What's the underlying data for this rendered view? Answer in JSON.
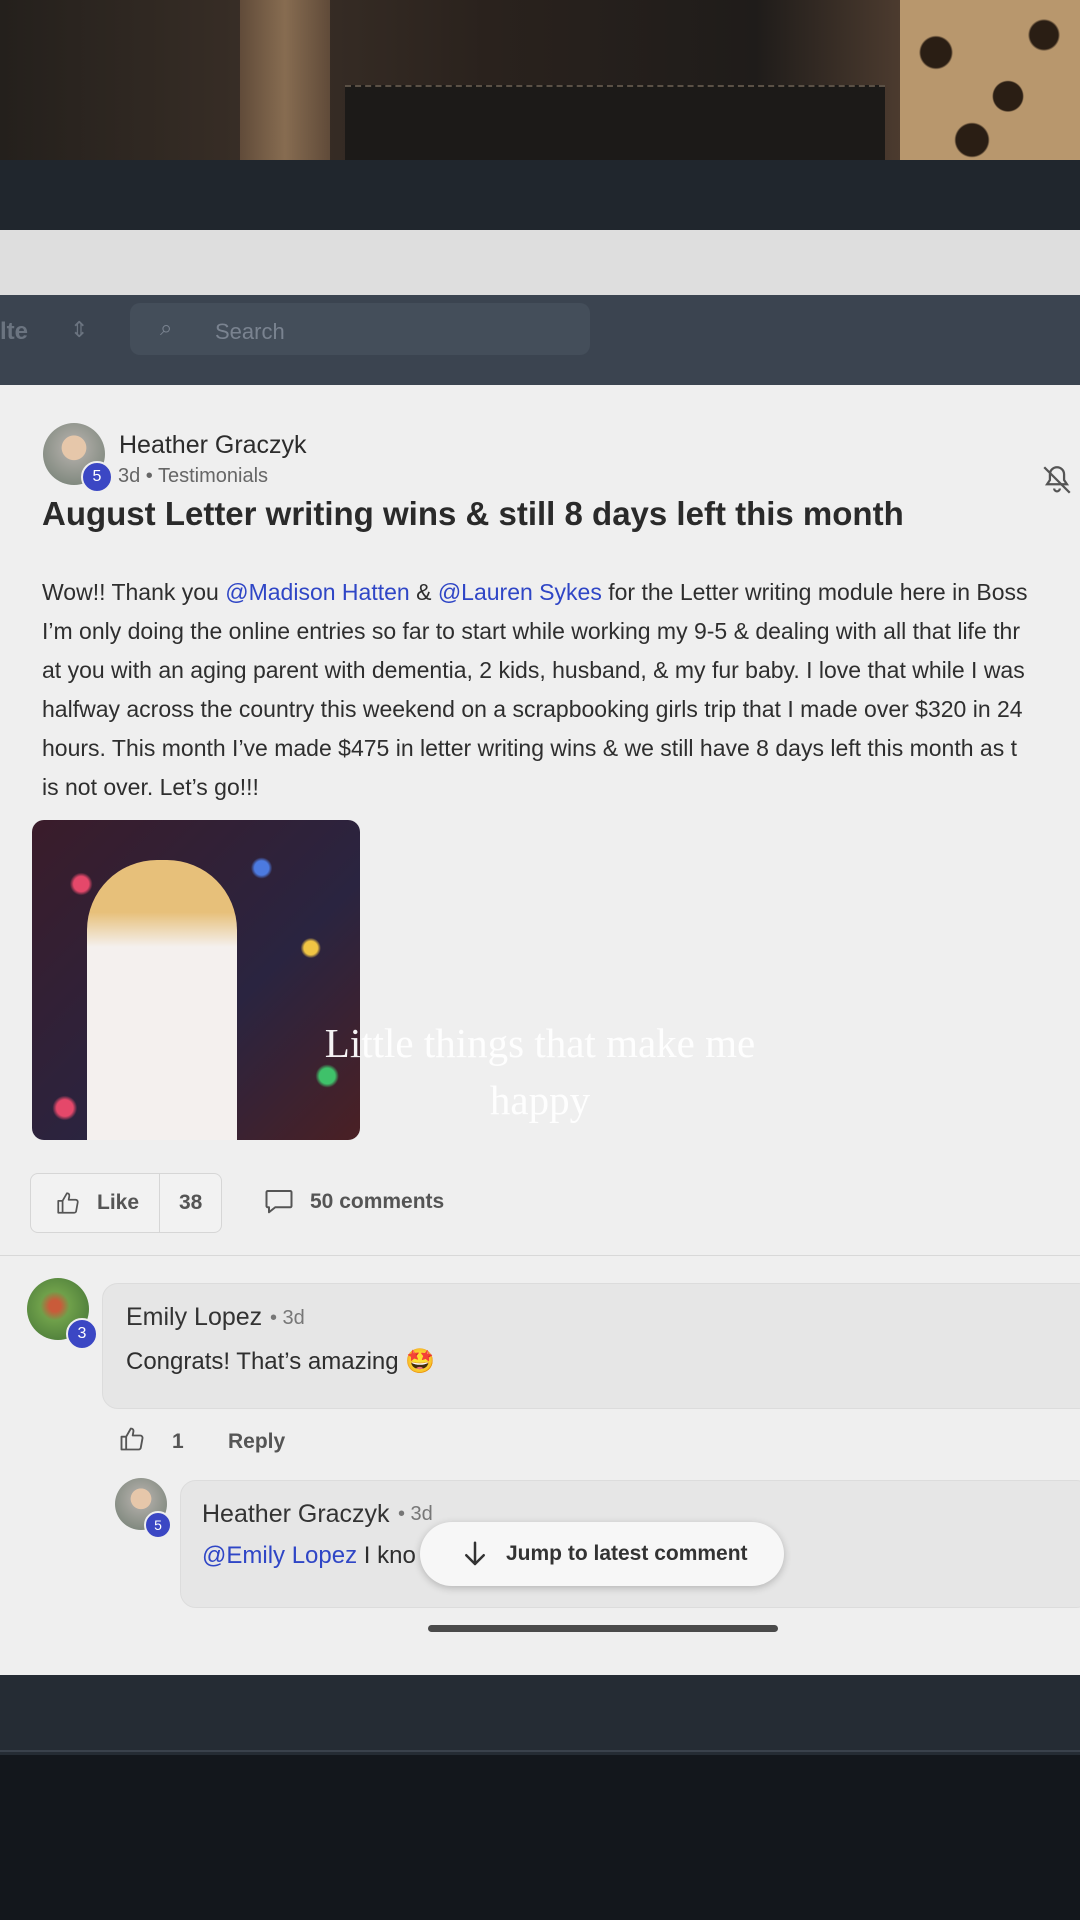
{
  "nav": {
    "partial_label": "lte",
    "search_placeholder": "Search"
  },
  "post": {
    "author": "Heather Graczyk",
    "author_level": "5",
    "meta": "3d • Testimonials",
    "title": "August Letter writing wins & still 8 days left this month",
    "body": {
      "line1_pre": "Wow!! Thank you ",
      "mention1": "@Madison Hatten",
      "line1_mid": " & ",
      "mention2": "@Lauren Sykes",
      "line1_post": " for the Letter writing module here in Boss",
      "line2": "I’m only doing the online entries so far to start while working my 9-5 & dealing with all that life thr",
      "line3": "at you with an aging parent with dementia, 2 kids, husband, & my fur baby. I love that while I was",
      "line4": "halfway across the country this weekend on a scrapbooking girls trip that I made over $320 in 24",
      "line5": "hours. This month I’ve made $475 in letter writing wins & we still have 8 days left this month as t",
      "line6": "is not over. Let’s go!!!"
    },
    "like_label": "Like",
    "like_count": "38",
    "comments_label": "50 comments"
  },
  "overlay_caption": {
    "line1": "Little things that make me",
    "line2": "happy"
  },
  "comments": [
    {
      "author": "Emily Lopez",
      "level": "3",
      "time": "• 3d",
      "text": "Congrats! That’s amazing 🤩",
      "like_count": "1",
      "reply_label": "Reply"
    }
  ],
  "reply": {
    "author": "Heather Graczyk",
    "level": "5",
    "time": "• 3d",
    "mention": "@Emily Lopez",
    "text": " I kno"
  },
  "jump_button_label": "Jump to latest comment",
  "icons": {
    "notification": "bell-off-icon",
    "like": "thumbs-up-icon",
    "comment": "speech-bubble-icon",
    "jump": "arrow-down-icon"
  },
  "colors": {
    "mention": "#2f46c6",
    "level_badge": "#3b47c4",
    "nav_bar": "#3b4450"
  }
}
